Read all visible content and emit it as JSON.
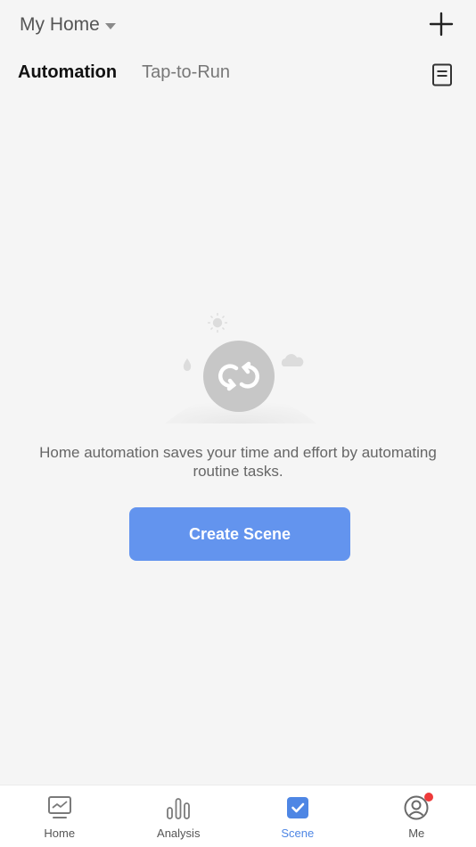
{
  "header": {
    "home_name": "My Home",
    "add_icon": "plus-icon"
  },
  "tabs": [
    {
      "label": "Automation",
      "active": true
    },
    {
      "label": "Tap-to-Run",
      "active": false
    }
  ],
  "log_icon": "document-icon",
  "empty_state": {
    "message": "Home automation saves your time and effort by automating routine tasks.",
    "illustration_icon": "loop-arrows-icon"
  },
  "create_button_label": "Create Scene",
  "bottom_nav": [
    {
      "label": "Home",
      "icon": "monitor-icon",
      "active": false
    },
    {
      "label": "Analysis",
      "icon": "bar-chart-icon",
      "active": false
    },
    {
      "label": "Scene",
      "icon": "checkbox-icon",
      "active": true
    },
    {
      "label": "Me",
      "icon": "user-circle-icon",
      "active": false,
      "badge": true
    }
  ],
  "colors": {
    "accent": "#6394ee",
    "active_nav": "#4e86e4",
    "background": "#f5f5f5",
    "badge": "#ee3a3a"
  }
}
